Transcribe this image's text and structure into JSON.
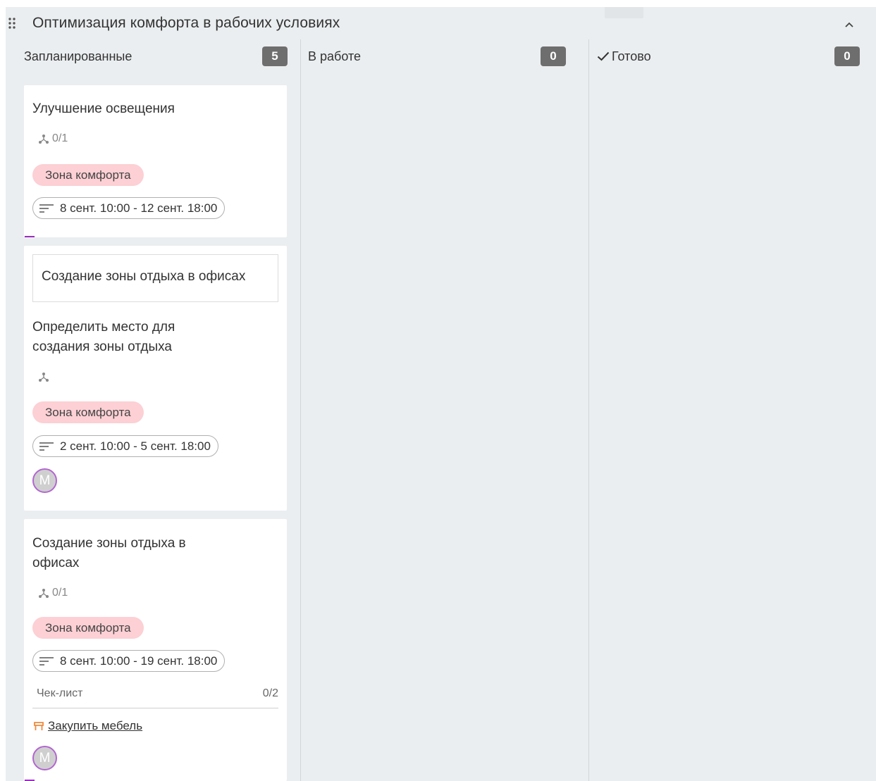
{
  "group": {
    "title": "Оптимизация комфорта в рабочих условиях",
    "drag_icon": "drag-handle-icon",
    "collapse_icon": "chevron-up-icon"
  },
  "columns": [
    {
      "title": "Запланированные",
      "count": "5"
    },
    {
      "title": "В работе",
      "count": "0"
    },
    {
      "title": "Готово",
      "count": "0",
      "icon": "check-icon"
    }
  ],
  "cards": [
    {
      "title": "Улучшение освещения",
      "subtasks": "0/1",
      "tag": "Зона комфорта",
      "dates": "8 сент. 10:00 - 12 сент. 18:00"
    },
    {
      "parent": "Создание зоны отдыха в офисах",
      "title": "Определить место для создания зоны отдыха",
      "tag": "Зона комфорта",
      "dates": "2 сент. 10:00 - 5 сент. 18:00",
      "assignee": "М"
    },
    {
      "title": "Создание зоны отдыха в офисах",
      "subtasks": "0/1",
      "tag": "Зона комфорта",
      "dates": "8 сент. 10:00 - 19 сент. 18:00",
      "checklist": {
        "label": "Чек-лист",
        "count": "0/2",
        "items": [
          "Закупить мебель"
        ]
      },
      "assignee": "М"
    }
  ],
  "colors": {
    "board_bg": "#ebeef0",
    "tag_bg": "#fcd0d4",
    "badge_bg": "#6e6e6e",
    "accent": "#9c2fbf",
    "checklist_icon": "#f08a3c"
  }
}
